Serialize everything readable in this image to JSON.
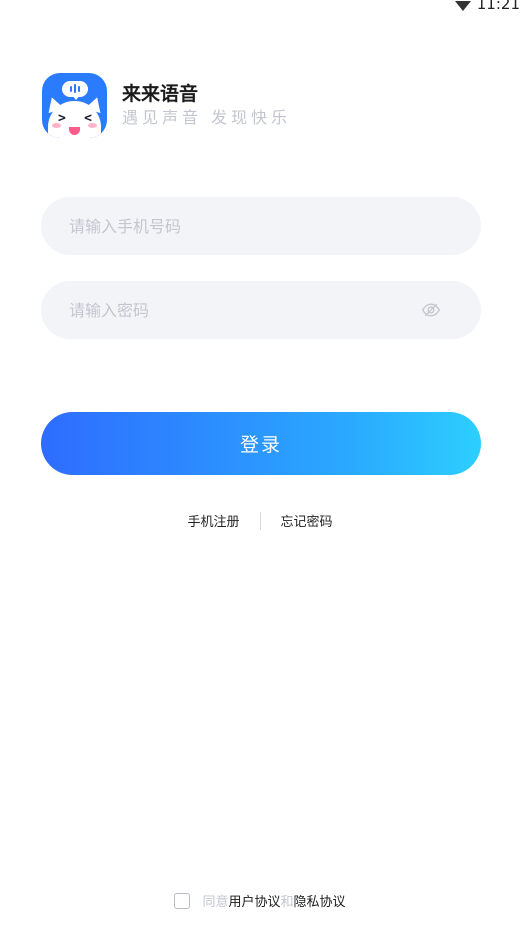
{
  "status_bar": {
    "time": "11:21",
    "wifi_icon": "wifi-icon"
  },
  "brand": {
    "logo_icon": "cat-mascot-icon",
    "title": "来来语音",
    "slogan": "遇见声音 发现快乐"
  },
  "form": {
    "phone_placeholder": "请输入手机号码",
    "phone_value": "",
    "password_placeholder": "请输入密码",
    "password_value": "",
    "password_toggle_icon": "eye-off-icon"
  },
  "actions": {
    "login_label": "登录",
    "register_label": "手机注册",
    "forgot_label": "忘记密码"
  },
  "agreement": {
    "checked": false,
    "prefix": "同意",
    "user_agreement": "用户协议",
    "conjunction": "和",
    "privacy_agreement": "隐私协议"
  },
  "colors": {
    "accent_start": "#2e6cff",
    "accent_end": "#2ccfff",
    "input_bg": "#f3f4f8",
    "muted_text": "#c3c6d0"
  }
}
